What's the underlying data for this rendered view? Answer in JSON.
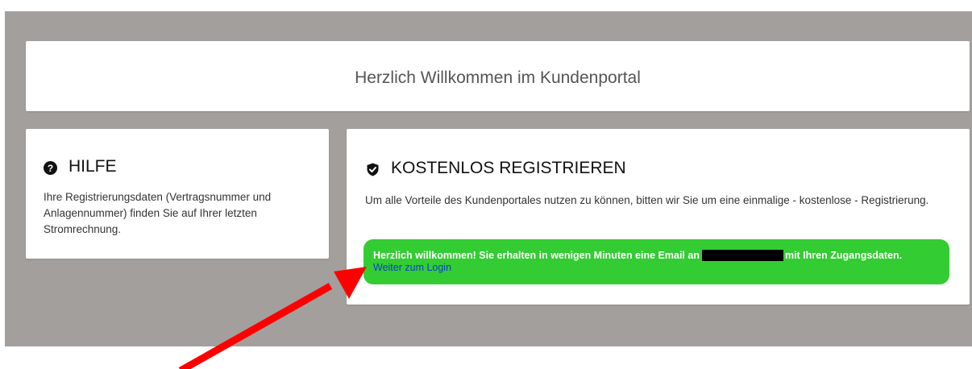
{
  "welcome": {
    "title": "Herzlich Willkommen im Kundenportal"
  },
  "help": {
    "icon": "question-circle-icon",
    "title": "HILFE",
    "text": "Ihre Registrierungsdaten (Vertragsnummer und Anlagennummer) finden Sie auf Ihrer letzten Stromrechnung."
  },
  "register": {
    "icon": "shield-check-icon",
    "title": "KOSTENLOS REGISTRIEREN",
    "text": "Um alle Vorteile des Kundenportales nutzen zu können, bitten wir Sie um eine einmalige - kostenlose - Registrierung.",
    "alert": {
      "message_before": "Herzlich willkommen! Sie erhalten in wenigen Minuten eine Email an",
      "message_after": "mit Ihren Zugangsdaten.",
      "link_label": "Weiter zum Login",
      "background_color": "#33cc33"
    }
  },
  "annotation": {
    "arrow_color": "#ff0000"
  },
  "colors": {
    "backdrop": "#a39f9d",
    "link": "#0a3fd2"
  }
}
